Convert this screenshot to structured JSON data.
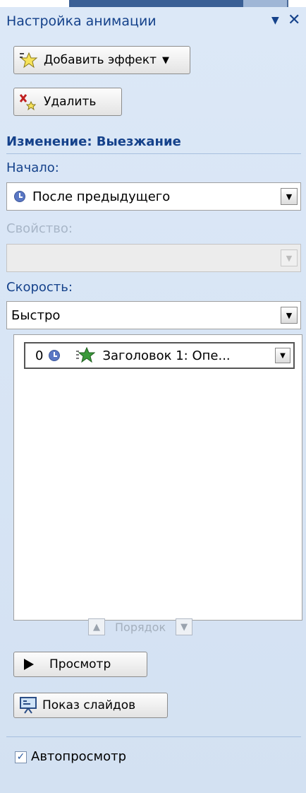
{
  "pane": {
    "title": "Настройка анимации",
    "dropdown_icon": "▼",
    "close_icon": "✕"
  },
  "toolbar": {
    "add_effect_label": "Добавить эффект",
    "add_effect_arrow": "▼",
    "remove_label": "Удалить"
  },
  "effect": {
    "heading": "Изменение: Выезжание",
    "start_label": "Начало:",
    "start_value": "После предыдущего",
    "property_label": "Свойство:",
    "property_value": "",
    "speed_label": "Скорость:",
    "speed_value": "Быстро"
  },
  "effect_list": {
    "items": [
      {
        "order": "0",
        "name": "Заголовок 1: Опе..."
      }
    ]
  },
  "reorder": {
    "label": "Порядок",
    "up_icon": "▲",
    "down_icon": "▼"
  },
  "bottom": {
    "preview_label": "Просмотр",
    "slideshow_label": "Показ слайдов",
    "autopreview_label": "Автопросмотр",
    "autopreview_checked": true,
    "check_mark": "✓"
  }
}
